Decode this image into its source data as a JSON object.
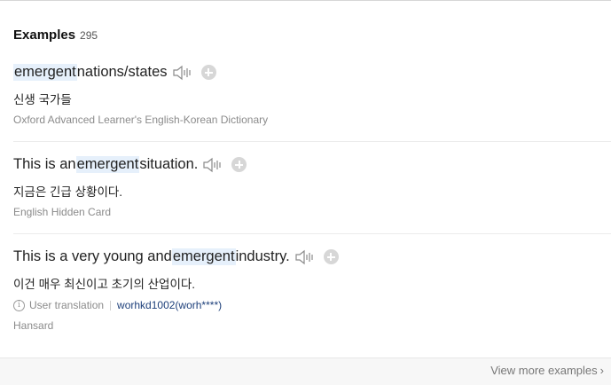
{
  "examples_header": {
    "title": "Examples",
    "count": "295"
  },
  "examples": [
    {
      "pre": "",
      "keyword": "emergent",
      "post": " nations/states",
      "translation": "신생 국가들",
      "source": "Oxford Advanced Learner's English-Korean Dictionary"
    },
    {
      "pre": "This is an ",
      "keyword": "emergent",
      "post": " situation.",
      "translation": "지금은 긴급 상황이다.",
      "source": "English Hidden Card"
    },
    {
      "pre": "This is a very young and ",
      "keyword": "emergent",
      "post": " industry.",
      "translation": "이건 매우 최신이고 초기의 산업이다.",
      "user_translation_label": "User translation",
      "user_id": "worhkd1002(worh****)",
      "source": "Hansard"
    }
  ],
  "icons": {
    "speaker": "speaker-icon",
    "add": "add-circle-icon",
    "info": "info-icon",
    "chevron": "chevron-right-icon"
  },
  "colors": {
    "highlight": "#e6f0fb",
    "link": "#1d3f7a",
    "muted": "#8b8b8b"
  },
  "footer": {
    "view_more": "View more examples",
    "chevron": "›"
  }
}
